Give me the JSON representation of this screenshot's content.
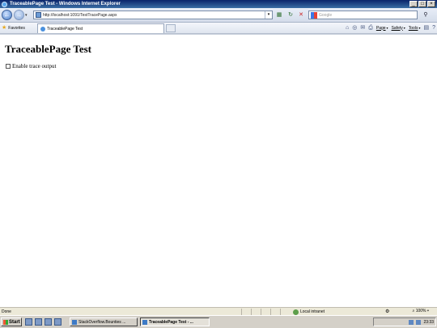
{
  "window": {
    "title": "TraceablePage Test - Windows Internet Explorer",
    "controls": [
      "_",
      "□",
      "×"
    ]
  },
  "address_bar": {
    "url": "http://localhost:1091/TestTracePage.aspx"
  },
  "search_box": {
    "placeholder": "Google"
  },
  "favorites_bar": {
    "favorites_label": "Favorites"
  },
  "tabs": [
    {
      "label": "TraceablePage Test",
      "active": true
    }
  ],
  "command_bar": {
    "items": [
      {
        "label": "Page",
        "icon": "page-icon"
      },
      {
        "label": "Safety",
        "icon": "safety-icon"
      },
      {
        "label": "Tools",
        "icon": "tools-icon"
      }
    ]
  },
  "page": {
    "title": "TraceablePage Test",
    "checkbox_label": "Enable trace output",
    "checkbox_checked": false
  },
  "status_bar": {
    "status": "Done",
    "zone": "Local intranet",
    "zoom": "100%"
  },
  "taskbar": {
    "start_label": "Start",
    "windows": [
      {
        "label": "StackOverflow.Bounties ...",
        "active": false
      },
      {
        "label": "TraceablePage Test - ...",
        "active": true
      }
    ],
    "clock": "23:33"
  },
  "colors": {
    "titlebar": "#0a246a",
    "chrome": "#dfe5ef",
    "taskbar": "#d4d0c8"
  }
}
